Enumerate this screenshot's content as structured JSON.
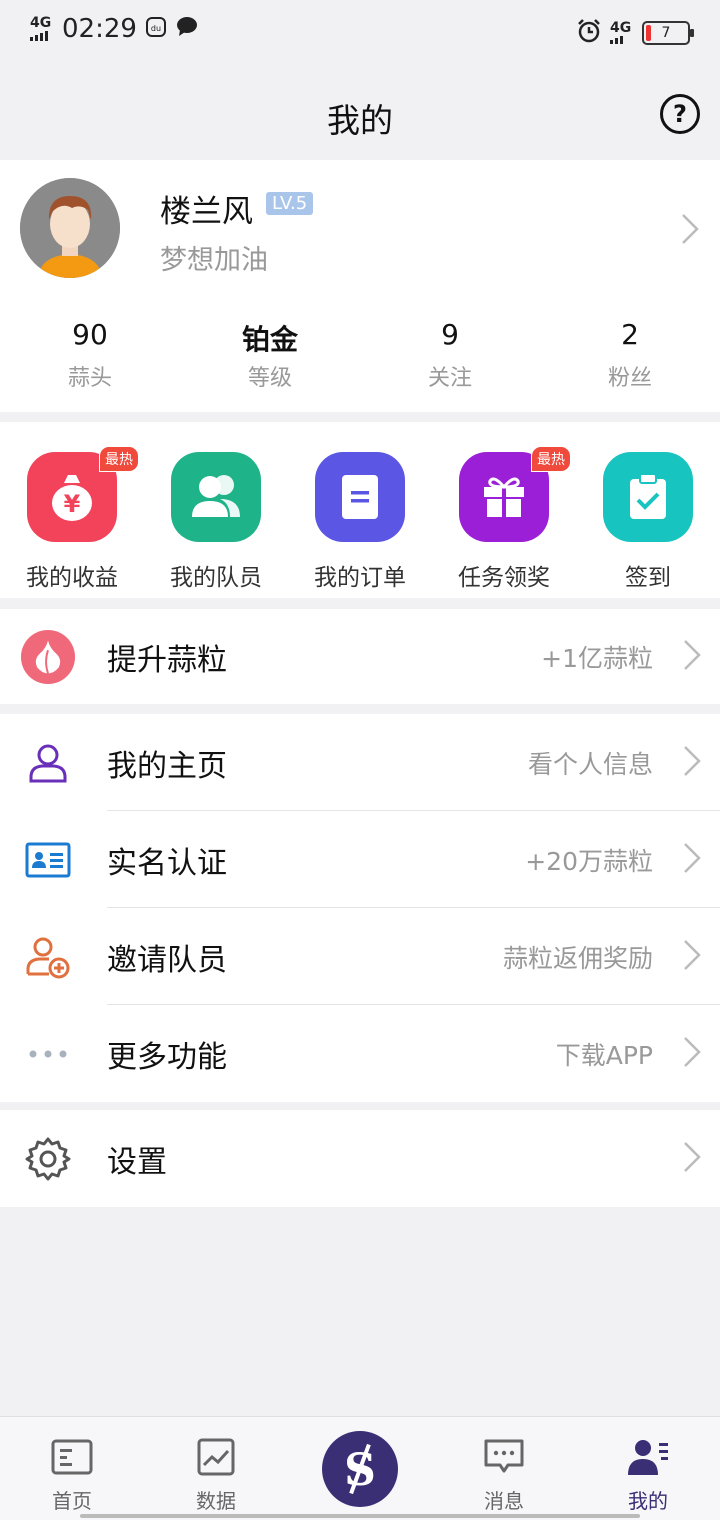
{
  "status_bar": {
    "network_left": "4G",
    "time": "02:29",
    "network_right": "4G",
    "battery": "7"
  },
  "header": {
    "title": "我的",
    "help": "?"
  },
  "profile": {
    "name": "楼兰风",
    "level": "LV.5",
    "motto": "梦想加油",
    "stats": [
      {
        "value": "90",
        "label": "蒜头"
      },
      {
        "value": "铂金",
        "label": "等级"
      },
      {
        "value": "9",
        "label": "关注"
      },
      {
        "value": "2",
        "label": "粉丝"
      }
    ]
  },
  "quick_actions": [
    {
      "label": "我的收益",
      "badge": "最热",
      "icon": "money-bag-icon",
      "color": "#f2435b"
    },
    {
      "label": "我的队员",
      "badge": "",
      "icon": "team-members-icon",
      "color": "#1fb38a"
    },
    {
      "label": "我的订单",
      "badge": "",
      "icon": "order-list-icon",
      "color": "#5b56e3"
    },
    {
      "label": "任务领奖",
      "badge": "最热",
      "icon": "gift-icon",
      "color": "#9a1fd6"
    },
    {
      "label": "签到",
      "badge": "",
      "icon": "checkin-clipboard-icon",
      "color": "#17c4c0"
    }
  ],
  "promo_row": {
    "label": "提升蒜粒",
    "value": "+1亿蒜粒",
    "icon": "garlic-icon"
  },
  "menu": [
    {
      "label": "我的主页",
      "value": "看个人信息",
      "icon": "user-profile-icon"
    },
    {
      "label": "实名认证",
      "value": "+20万蒜粒",
      "icon": "id-card-icon"
    },
    {
      "label": "邀请队员",
      "value": "蒜粒返佣奖励",
      "icon": "invite-user-icon"
    },
    {
      "label": "更多功能",
      "value": "下载APP",
      "icon": "more-dots-icon"
    }
  ],
  "settings": {
    "label": "设置",
    "icon": "gear-icon"
  },
  "bottom_nav": [
    {
      "label": "首页",
      "icon": "home-news-icon"
    },
    {
      "label": "数据",
      "icon": "chart-icon"
    },
    {
      "label": "",
      "icon": "dollar-logo-icon"
    },
    {
      "label": "消息",
      "icon": "message-icon"
    },
    {
      "label": "我的",
      "icon": "profile-icon"
    }
  ],
  "colors": {
    "accent": "#3a2e74",
    "hot_badge": "#f04a3c",
    "lv_badge": "#a9c6ea"
  }
}
